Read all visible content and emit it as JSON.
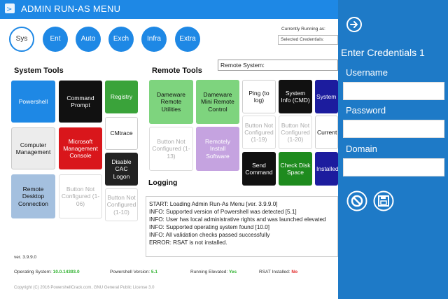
{
  "window": {
    "title": "ADMIN RUN-AS MENU"
  },
  "tabs": [
    {
      "label": "Sys"
    },
    {
      "label": "Ent"
    },
    {
      "label": "Auto"
    },
    {
      "label": "Exch"
    },
    {
      "label": "Infra"
    },
    {
      "label": "Extra"
    }
  ],
  "header": {
    "currently_running_label": "Currently Running as:",
    "selected_credentials_placeholder": "Selected Credentials:",
    "remote_system_label": "Remote System:"
  },
  "system_tools": {
    "heading": "System Tools",
    "tiles": [
      "Powershell",
      "Command Prompt",
      "Registry",
      "Computer Management",
      "Microsoft Management Console",
      "CMtrace",
      "Disable CAC Logon",
      "Remote Desktop Connection",
      "Button Not Configured (1-06)",
      "Button Not Configured (1-10)"
    ]
  },
  "remote_tools": {
    "heading": "Remote Tools",
    "tiles": [
      "Dameware Remote Utilities",
      "Dameware Mini Remote Control",
      "Ping (to log)",
      "System Info (CMD)",
      "System Info (PS)",
      "Button Not Configured (1-13)",
      "Remotely Install Software",
      "Button Not Configured (1-19)",
      "Button Not Configured (1-20)",
      "Current User",
      "Send Command",
      "Check Disk Space",
      "Installed Software"
    ]
  },
  "logging": {
    "heading": "Logging",
    "lines": [
      "START: Loading Admin Run-As Menu [ver. 3.9.9.0]",
      "INFO: Supported version of Powershell was detected [5.1]",
      "INFO: User has local administrative rights and was launched elevated",
      "INFO: Supported operating system found [10.0]",
      "INFO: All validation checks passed successfully",
      "ERROR: RSAT is not installed."
    ]
  },
  "footer": {
    "version": "ver. 3.9.9.0",
    "os_label": "Operating System:",
    "os_value": "10.0.14393.0",
    "ps_label": "Powershell Version:",
    "ps_value": "5.1",
    "elevated_label": "Running Elevated:",
    "elevated_value": "Yes",
    "rsat_label": "RSAT Installed:",
    "rsat_value": "No",
    "copyright": "Copyright (C) 2016 PowershellCrack.com, GNU General Public License 3.0"
  },
  "flyout": {
    "heading": "Enter Credentials 1",
    "username_label": "Username",
    "password_label": "Password",
    "domain_label": "Domain"
  },
  "colors": {
    "accent": "#1e88e5",
    "flyout": "#1e7ac7",
    "success": "#2bb02b",
    "error": "#e02020"
  },
  "icons": [
    "back-arrow-icon",
    "cancel-icon",
    "save-icon",
    "app-logo-icon"
  ]
}
